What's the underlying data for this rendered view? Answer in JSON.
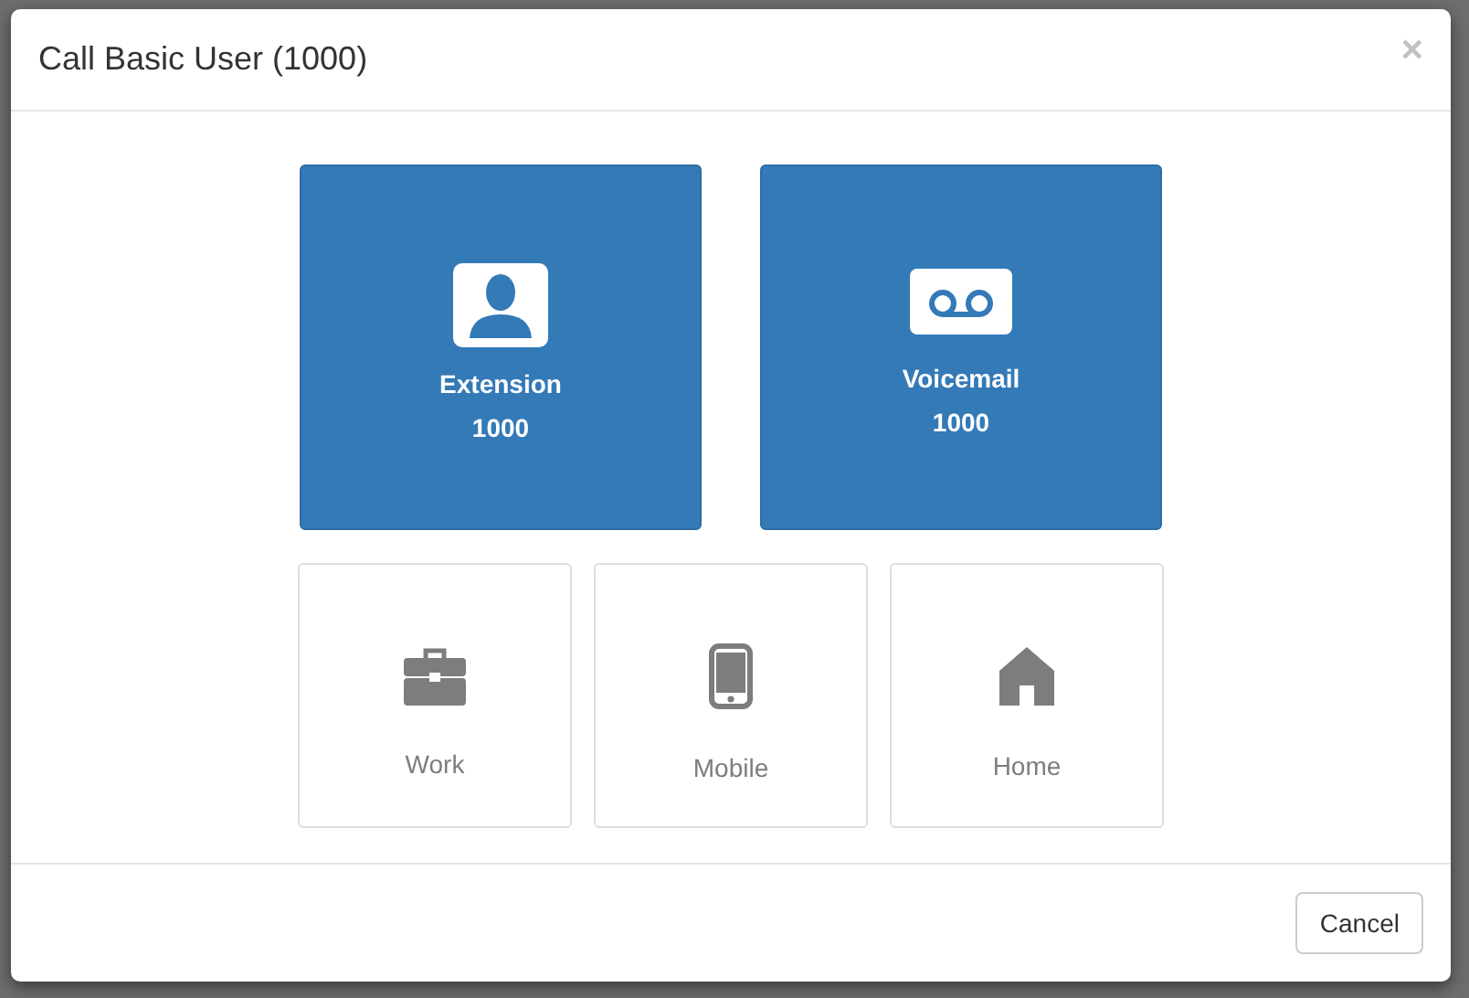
{
  "dialog": {
    "title": "Call Basic User (1000)",
    "close": "×"
  },
  "primary_options": [
    {
      "kind": "extension",
      "label": "Extension",
      "number": "1000"
    },
    {
      "kind": "voicemail",
      "label": "Voicemail",
      "number": "1000"
    }
  ],
  "other_options": [
    {
      "kind": "work",
      "label": "Work",
      "disabled": true
    },
    {
      "kind": "mobile",
      "label": "Mobile",
      "disabled": true
    },
    {
      "kind": "home",
      "label": "Home",
      "disabled": true
    }
  ],
  "buttons": [
    "Cancel"
  ]
}
